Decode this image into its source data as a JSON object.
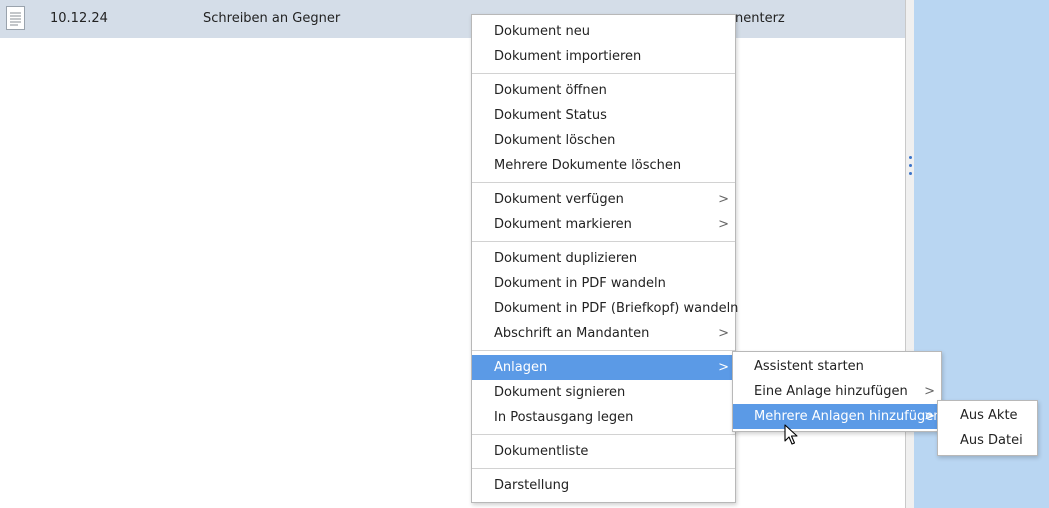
{
  "document_row": {
    "icon": "document-icon",
    "date": "10.12.24",
    "title": "Schreiben an Gegner",
    "extra": "nenterz"
  },
  "context_menu": {
    "items": [
      {
        "label": "Dokument neu"
      },
      {
        "label": "Dokument importieren"
      },
      {
        "label": "Dokument öffnen"
      },
      {
        "label": "Dokument Status"
      },
      {
        "label": "Dokument löschen"
      },
      {
        "label": "Mehrere Dokumente löschen"
      },
      {
        "label": "Dokument verfügen",
        "submenu": true
      },
      {
        "label": "Dokument markieren",
        "submenu": true
      },
      {
        "label": "Dokument duplizieren"
      },
      {
        "label": "Dokument in PDF wandeln"
      },
      {
        "label": "Dokument in PDF (Briefkopf) wandeln"
      },
      {
        "label": "Abschrift an Mandanten",
        "submenu": true
      },
      {
        "label": "Anlagen",
        "submenu": true,
        "highlighted": true
      },
      {
        "label": "Dokument signieren"
      },
      {
        "label": "In Postausgang legen"
      },
      {
        "label": "Dokumentliste"
      },
      {
        "label": "Darstellung"
      }
    ]
  },
  "anlagen_submenu": {
    "items": [
      {
        "label": "Assistent starten"
      },
      {
        "label": "Eine Anlage hinzufügen",
        "submenu": true
      },
      {
        "label": "Mehrere Anlagen hinzufügen",
        "submenu": true,
        "highlighted": true
      }
    ]
  },
  "mehrere_submenu": {
    "items": [
      {
        "label": "Aus Akte"
      },
      {
        "label": "Aus Datei"
      }
    ]
  },
  "submenu_arrow": ">",
  "colors": {
    "row_selected": "#d4dde8",
    "menu_highlight": "#5b9ae6",
    "right_pane": "#b9d6f2"
  }
}
